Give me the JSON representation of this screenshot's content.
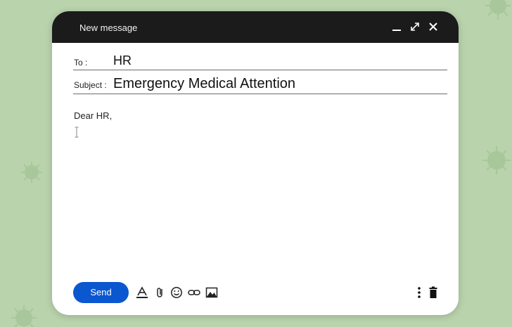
{
  "window": {
    "title": "New message",
    "controls": [
      "minimize-icon",
      "expand-icon",
      "close-icon"
    ]
  },
  "to": {
    "label": "To :",
    "value": "HR"
  },
  "subject": {
    "label": "Subject :",
    "value": "Emergency Medical Attention"
  },
  "body": {
    "greeting": "Dear HR,"
  },
  "toolbar": {
    "send_label": "Send",
    "icons": [
      "text-format-icon",
      "attach-icon",
      "emoji-icon",
      "link-icon",
      "insert-photo-icon",
      "more-options-icon",
      "trash-icon"
    ]
  },
  "colors": {
    "background": "#b9d3ad",
    "titlebar": "#1b1b1b",
    "send_button": "#0b57d0"
  }
}
